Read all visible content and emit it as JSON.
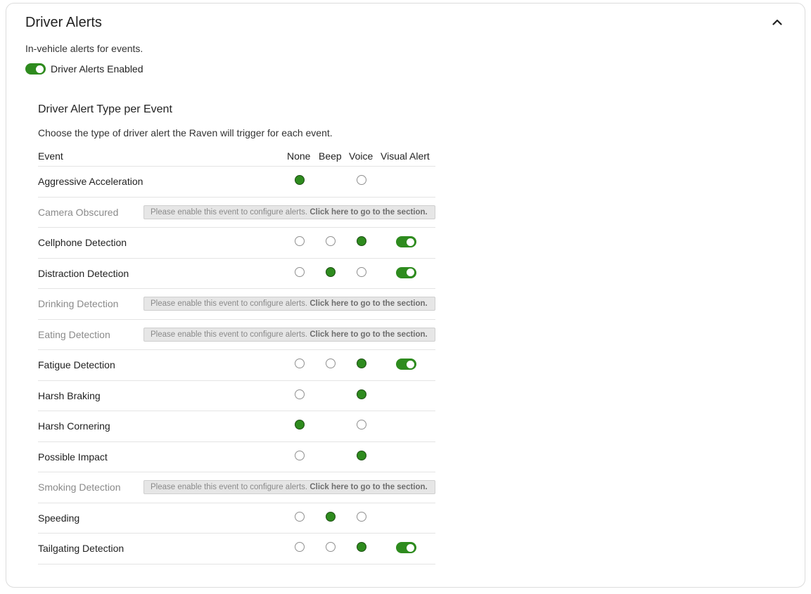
{
  "card": {
    "title": "Driver Alerts",
    "subtitle": "In-vehicle alerts for events.",
    "master_toggle": {
      "label": "Driver Alerts Enabled",
      "on": true
    }
  },
  "section": {
    "title": "Driver Alert Type per Event",
    "description": "Choose the type of driver alert the Raven will trigger for each event."
  },
  "columns": {
    "event": "Event",
    "none": "None",
    "beep": "Beep",
    "voice": "Voice",
    "visual": "Visual Alert"
  },
  "notice": {
    "text": "Please enable this event to configure alerts.",
    "link": "Click here to go to the section."
  },
  "colors": {
    "accent": "#2e8b1e",
    "disabled_text": "#8a8a8a",
    "notice_bg": "#e6e6e6"
  },
  "events": [
    {
      "name": "Aggressive Acceleration",
      "enabled": true,
      "options": [
        "none",
        "voice"
      ],
      "selected": "none",
      "visual": null
    },
    {
      "name": "Camera Obscured",
      "enabled": false
    },
    {
      "name": "Cellphone Detection",
      "enabled": true,
      "options": [
        "none",
        "beep",
        "voice"
      ],
      "selected": "voice",
      "visual": true
    },
    {
      "name": "Distraction Detection",
      "enabled": true,
      "options": [
        "none",
        "beep",
        "voice"
      ],
      "selected": "beep",
      "visual": true
    },
    {
      "name": "Drinking Detection",
      "enabled": false
    },
    {
      "name": "Eating Detection",
      "enabled": false
    },
    {
      "name": "Fatigue Detection",
      "enabled": true,
      "options": [
        "none",
        "beep",
        "voice"
      ],
      "selected": "voice",
      "visual": true
    },
    {
      "name": "Harsh Braking",
      "enabled": true,
      "options": [
        "none",
        "voice"
      ],
      "selected": "voice",
      "visual": null
    },
    {
      "name": "Harsh Cornering",
      "enabled": true,
      "options": [
        "none",
        "voice"
      ],
      "selected": "none",
      "visual": null
    },
    {
      "name": "Possible Impact",
      "enabled": true,
      "options": [
        "none",
        "voice"
      ],
      "selected": "voice",
      "visual": null
    },
    {
      "name": "Smoking Detection",
      "enabled": false
    },
    {
      "name": "Speeding",
      "enabled": true,
      "options": [
        "none",
        "beep",
        "voice"
      ],
      "selected": "beep",
      "visual": null
    },
    {
      "name": "Tailgating Detection",
      "enabled": true,
      "options": [
        "none",
        "beep",
        "voice"
      ],
      "selected": "voice",
      "visual": true
    }
  ]
}
